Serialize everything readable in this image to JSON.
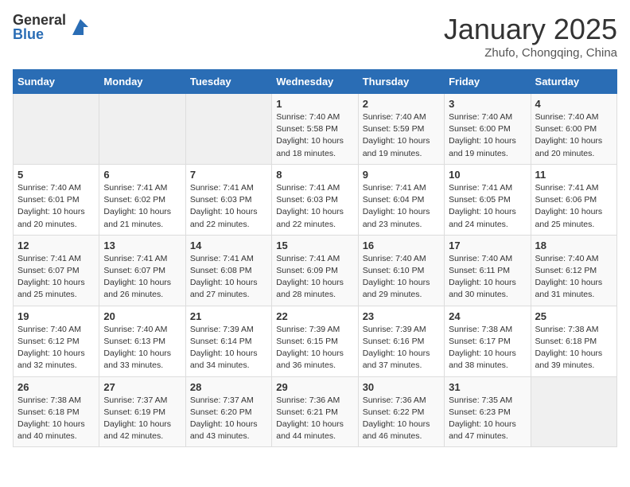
{
  "header": {
    "logo_general": "General",
    "logo_blue": "Blue",
    "month": "January 2025",
    "location": "Zhufo, Chongqing, China"
  },
  "weekdays": [
    "Sunday",
    "Monday",
    "Tuesday",
    "Wednesday",
    "Thursday",
    "Friday",
    "Saturday"
  ],
  "weeks": [
    [
      {
        "day": "",
        "info": ""
      },
      {
        "day": "",
        "info": ""
      },
      {
        "day": "",
        "info": ""
      },
      {
        "day": "1",
        "info": "Sunrise: 7:40 AM\nSunset: 5:58 PM\nDaylight: 10 hours and 18 minutes."
      },
      {
        "day": "2",
        "info": "Sunrise: 7:40 AM\nSunset: 5:59 PM\nDaylight: 10 hours and 19 minutes."
      },
      {
        "day": "3",
        "info": "Sunrise: 7:40 AM\nSunset: 6:00 PM\nDaylight: 10 hours and 19 minutes."
      },
      {
        "day": "4",
        "info": "Sunrise: 7:40 AM\nSunset: 6:00 PM\nDaylight: 10 hours and 20 minutes."
      }
    ],
    [
      {
        "day": "5",
        "info": "Sunrise: 7:40 AM\nSunset: 6:01 PM\nDaylight: 10 hours and 20 minutes."
      },
      {
        "day": "6",
        "info": "Sunrise: 7:41 AM\nSunset: 6:02 PM\nDaylight: 10 hours and 21 minutes."
      },
      {
        "day": "7",
        "info": "Sunrise: 7:41 AM\nSunset: 6:03 PM\nDaylight: 10 hours and 22 minutes."
      },
      {
        "day": "8",
        "info": "Sunrise: 7:41 AM\nSunset: 6:03 PM\nDaylight: 10 hours and 22 minutes."
      },
      {
        "day": "9",
        "info": "Sunrise: 7:41 AM\nSunset: 6:04 PM\nDaylight: 10 hours and 23 minutes."
      },
      {
        "day": "10",
        "info": "Sunrise: 7:41 AM\nSunset: 6:05 PM\nDaylight: 10 hours and 24 minutes."
      },
      {
        "day": "11",
        "info": "Sunrise: 7:41 AM\nSunset: 6:06 PM\nDaylight: 10 hours and 25 minutes."
      }
    ],
    [
      {
        "day": "12",
        "info": "Sunrise: 7:41 AM\nSunset: 6:07 PM\nDaylight: 10 hours and 25 minutes."
      },
      {
        "day": "13",
        "info": "Sunrise: 7:41 AM\nSunset: 6:07 PM\nDaylight: 10 hours and 26 minutes."
      },
      {
        "day": "14",
        "info": "Sunrise: 7:41 AM\nSunset: 6:08 PM\nDaylight: 10 hours and 27 minutes."
      },
      {
        "day": "15",
        "info": "Sunrise: 7:41 AM\nSunset: 6:09 PM\nDaylight: 10 hours and 28 minutes."
      },
      {
        "day": "16",
        "info": "Sunrise: 7:40 AM\nSunset: 6:10 PM\nDaylight: 10 hours and 29 minutes."
      },
      {
        "day": "17",
        "info": "Sunrise: 7:40 AM\nSunset: 6:11 PM\nDaylight: 10 hours and 30 minutes."
      },
      {
        "day": "18",
        "info": "Sunrise: 7:40 AM\nSunset: 6:12 PM\nDaylight: 10 hours and 31 minutes."
      }
    ],
    [
      {
        "day": "19",
        "info": "Sunrise: 7:40 AM\nSunset: 6:12 PM\nDaylight: 10 hours and 32 minutes."
      },
      {
        "day": "20",
        "info": "Sunrise: 7:40 AM\nSunset: 6:13 PM\nDaylight: 10 hours and 33 minutes."
      },
      {
        "day": "21",
        "info": "Sunrise: 7:39 AM\nSunset: 6:14 PM\nDaylight: 10 hours and 34 minutes."
      },
      {
        "day": "22",
        "info": "Sunrise: 7:39 AM\nSunset: 6:15 PM\nDaylight: 10 hours and 36 minutes."
      },
      {
        "day": "23",
        "info": "Sunrise: 7:39 AM\nSunset: 6:16 PM\nDaylight: 10 hours and 37 minutes."
      },
      {
        "day": "24",
        "info": "Sunrise: 7:38 AM\nSunset: 6:17 PM\nDaylight: 10 hours and 38 minutes."
      },
      {
        "day": "25",
        "info": "Sunrise: 7:38 AM\nSunset: 6:18 PM\nDaylight: 10 hours and 39 minutes."
      }
    ],
    [
      {
        "day": "26",
        "info": "Sunrise: 7:38 AM\nSunset: 6:18 PM\nDaylight: 10 hours and 40 minutes."
      },
      {
        "day": "27",
        "info": "Sunrise: 7:37 AM\nSunset: 6:19 PM\nDaylight: 10 hours and 42 minutes."
      },
      {
        "day": "28",
        "info": "Sunrise: 7:37 AM\nSunset: 6:20 PM\nDaylight: 10 hours and 43 minutes."
      },
      {
        "day": "29",
        "info": "Sunrise: 7:36 AM\nSunset: 6:21 PM\nDaylight: 10 hours and 44 minutes."
      },
      {
        "day": "30",
        "info": "Sunrise: 7:36 AM\nSunset: 6:22 PM\nDaylight: 10 hours and 46 minutes."
      },
      {
        "day": "31",
        "info": "Sunrise: 7:35 AM\nSunset: 6:23 PM\nDaylight: 10 hours and 47 minutes."
      },
      {
        "day": "",
        "info": ""
      }
    ]
  ]
}
